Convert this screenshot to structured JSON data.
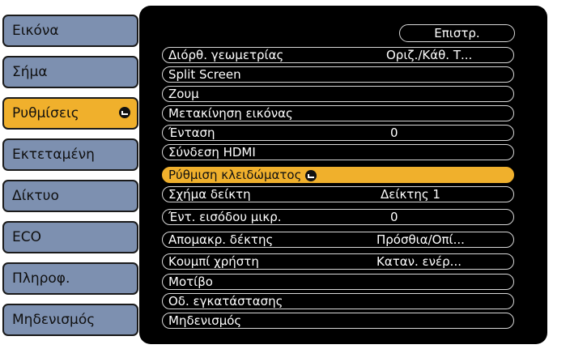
{
  "sidebar": {
    "items": [
      {
        "label": "Εικόνα",
        "active": false
      },
      {
        "label": "Σήμα",
        "active": false
      },
      {
        "label": "Ρυθμίσεις",
        "active": true
      },
      {
        "label": "Εκτεταμένη",
        "active": false
      },
      {
        "label": "Δίκτυο",
        "active": false
      },
      {
        "label": "ECO",
        "active": false
      },
      {
        "label": "Πληροφ.",
        "active": false
      },
      {
        "label": "Μηδενισμός",
        "active": false
      }
    ]
  },
  "menu": {
    "back_label": "Επιστρ.",
    "rows": [
      {
        "label": "Διόρθ. γεωμετρίας",
        "value": "Οριζ./Κάθ. Τ..."
      },
      {
        "label": "Split Screen",
        "value": ""
      },
      {
        "label": "Ζουμ",
        "value": ""
      },
      {
        "label": "Μετακίνηση εικόνας",
        "value": ""
      },
      {
        "label": "Ένταση",
        "value": "0"
      },
      {
        "label": "Σύνδεση HDMI",
        "value": ""
      },
      {
        "label": "Ρύθμιση κλειδώματος",
        "value": "",
        "selected": true
      },
      {
        "label": "Σχήμα δείκτη",
        "value": "Δείκτης 1"
      },
      {
        "label": "Έντ. εισόδου μικρ.",
        "value": "0"
      },
      {
        "label": "Απομακρ. δέκτης",
        "value": "Πρόσθια/Οπί..."
      },
      {
        "label": "Κουμπί χρήστη",
        "value": "Καταν. ενέρ..."
      },
      {
        "label": "Μοτίβο",
        "value": ""
      },
      {
        "label": "Οδ. εγκατάστασης",
        "value": ""
      },
      {
        "label": "Μηδενισμός",
        "value": ""
      }
    ]
  },
  "colors": {
    "tab": "#7d90b0",
    "accent": "#f0b02c",
    "panel": "#000000"
  }
}
